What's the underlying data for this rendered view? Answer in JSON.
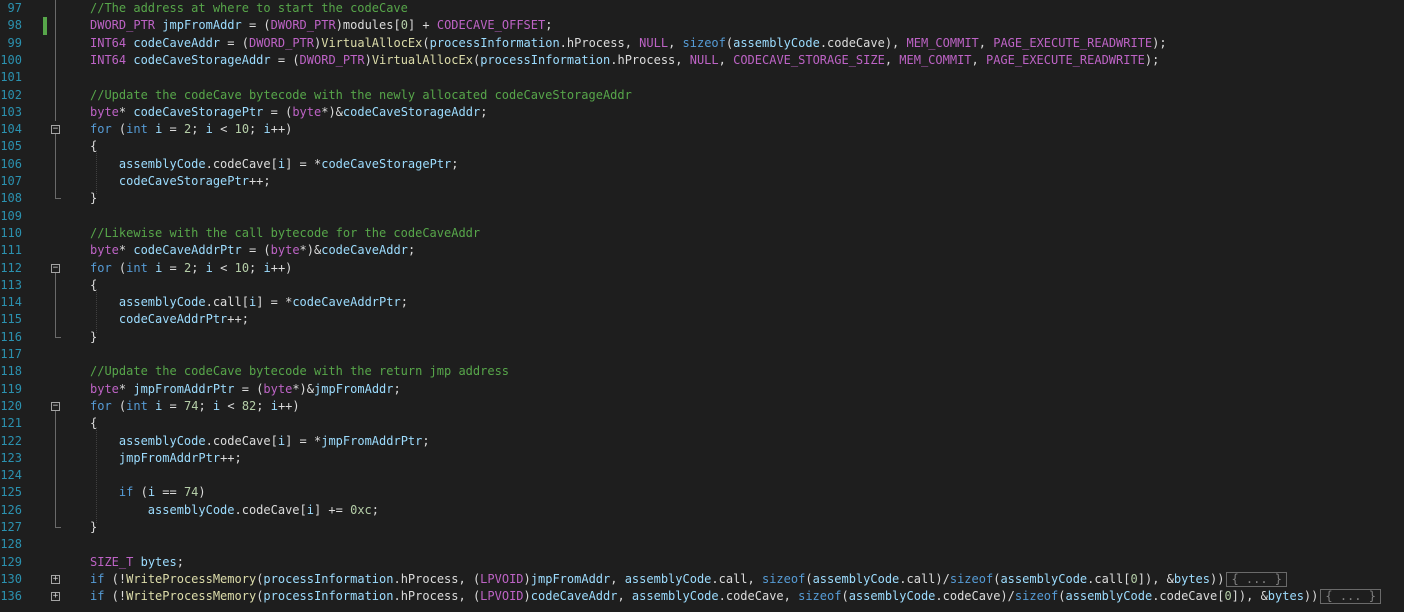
{
  "editor": {
    "colors": {
      "background": "#1e1e1e",
      "line_number": "#2b91af",
      "comment": "#57a64a",
      "keyword": "#569cd6",
      "macro": "#bd63c5",
      "function": "#dcdcaa",
      "variable": "#9cdcfe",
      "number": "#b5cea8",
      "plain": "#dcdcdc",
      "change_bar": "#57a64a"
    },
    "collapsed_label": "{ ... }",
    "lines": [
      {
        "n": "97",
        "tokens": [
          [
            "comment",
            "//The address at where to start the codeCave"
          ]
        ]
      },
      {
        "n": "98",
        "tokens": [
          [
            "macro",
            "DWORD_PTR"
          ],
          [
            "plain",
            " "
          ],
          [
            "var",
            "jmpFromAddr"
          ],
          [
            "plain",
            " = ("
          ],
          [
            "macro",
            "DWORD_PTR"
          ],
          [
            "plain",
            ")modules["
          ],
          [
            "num",
            "0"
          ],
          [
            "plain",
            "] + "
          ],
          [
            "macro",
            "CODECAVE_OFFSET"
          ],
          [
            "plain",
            ";"
          ]
        ]
      },
      {
        "n": "99",
        "tokens": [
          [
            "macro",
            "INT64"
          ],
          [
            "plain",
            " "
          ],
          [
            "var",
            "codeCaveAddr"
          ],
          [
            "plain",
            " = ("
          ],
          [
            "macro",
            "DWORD_PTR"
          ],
          [
            "plain",
            ")"
          ],
          [
            "fn",
            "VirtualAllocEx"
          ],
          [
            "plain",
            "("
          ],
          [
            "var",
            "processInformation"
          ],
          [
            "plain",
            ".hProcess, "
          ],
          [
            "macro",
            "NULL"
          ],
          [
            "plain",
            ", "
          ],
          [
            "kw",
            "sizeof"
          ],
          [
            "plain",
            "("
          ],
          [
            "var",
            "assemblyCode"
          ],
          [
            "plain",
            ".codeCave), "
          ],
          [
            "macro",
            "MEM_COMMIT"
          ],
          [
            "plain",
            ", "
          ],
          [
            "macro",
            "PAGE_EXECUTE_READWRITE"
          ],
          [
            "plain",
            ");"
          ]
        ]
      },
      {
        "n": "100",
        "tokens": [
          [
            "macro",
            "INT64"
          ],
          [
            "plain",
            " "
          ],
          [
            "var",
            "codeCaveStorageAddr"
          ],
          [
            "plain",
            " = ("
          ],
          [
            "macro",
            "DWORD_PTR"
          ],
          [
            "plain",
            ")"
          ],
          [
            "fn",
            "VirtualAllocEx"
          ],
          [
            "plain",
            "("
          ],
          [
            "var",
            "processInformation"
          ],
          [
            "plain",
            ".hProcess, "
          ],
          [
            "macro",
            "NULL"
          ],
          [
            "plain",
            ", "
          ],
          [
            "macro",
            "CODECAVE_STORAGE_SIZE"
          ],
          [
            "plain",
            ", "
          ],
          [
            "macro",
            "MEM_COMMIT"
          ],
          [
            "plain",
            ", "
          ],
          [
            "macro",
            "PAGE_EXECUTE_READWRITE"
          ],
          [
            "plain",
            ");"
          ]
        ]
      },
      {
        "n": "101",
        "tokens": []
      },
      {
        "n": "102",
        "tokens": [
          [
            "comment",
            "//Update the codeCave bytecode with the newly allocated codeCaveStorageAddr"
          ]
        ]
      },
      {
        "n": "103",
        "tokens": [
          [
            "macro",
            "byte"
          ],
          [
            "plain",
            "* "
          ],
          [
            "var",
            "codeCaveStoragePtr"
          ],
          [
            "plain",
            " = ("
          ],
          [
            "macro",
            "byte"
          ],
          [
            "plain",
            "*)&"
          ],
          [
            "var",
            "codeCaveStorageAddr"
          ],
          [
            "plain",
            ";"
          ]
        ]
      },
      {
        "n": "104",
        "tokens": [
          [
            "kw",
            "for"
          ],
          [
            "plain",
            " ("
          ],
          [
            "kw",
            "int"
          ],
          [
            "plain",
            " "
          ],
          [
            "var",
            "i"
          ],
          [
            "plain",
            " = "
          ],
          [
            "num",
            "2"
          ],
          [
            "plain",
            "; "
          ],
          [
            "var",
            "i"
          ],
          [
            "plain",
            " < "
          ],
          [
            "num",
            "10"
          ],
          [
            "plain",
            "; "
          ],
          [
            "var",
            "i"
          ],
          [
            "plain",
            "++)"
          ]
        ]
      },
      {
        "n": "105",
        "tokens": [
          [
            "plain",
            "{"
          ]
        ]
      },
      {
        "n": "106",
        "tokens": [
          [
            "plain",
            "    "
          ],
          [
            "var",
            "assemblyCode"
          ],
          [
            "plain",
            ".codeCave["
          ],
          [
            "var",
            "i"
          ],
          [
            "plain",
            "] = *"
          ],
          [
            "var",
            "codeCaveStoragePtr"
          ],
          [
            "plain",
            ";"
          ]
        ]
      },
      {
        "n": "107",
        "tokens": [
          [
            "plain",
            "    "
          ],
          [
            "var",
            "codeCaveStoragePtr"
          ],
          [
            "plain",
            "++;"
          ]
        ]
      },
      {
        "n": "108",
        "tokens": [
          [
            "plain",
            "}"
          ]
        ]
      },
      {
        "n": "109",
        "tokens": []
      },
      {
        "n": "110",
        "tokens": [
          [
            "comment",
            "//Likewise with the call bytecode for the codeCaveAddr"
          ]
        ]
      },
      {
        "n": "111",
        "tokens": [
          [
            "macro",
            "byte"
          ],
          [
            "plain",
            "* "
          ],
          [
            "var",
            "codeCaveAddrPtr"
          ],
          [
            "plain",
            " = ("
          ],
          [
            "macro",
            "byte"
          ],
          [
            "plain",
            "*)&"
          ],
          [
            "var",
            "codeCaveAddr"
          ],
          [
            "plain",
            ";"
          ]
        ]
      },
      {
        "n": "112",
        "tokens": [
          [
            "kw",
            "for"
          ],
          [
            "plain",
            " ("
          ],
          [
            "kw",
            "int"
          ],
          [
            "plain",
            " "
          ],
          [
            "var",
            "i"
          ],
          [
            "plain",
            " = "
          ],
          [
            "num",
            "2"
          ],
          [
            "plain",
            "; "
          ],
          [
            "var",
            "i"
          ],
          [
            "plain",
            " < "
          ],
          [
            "num",
            "10"
          ],
          [
            "plain",
            "; "
          ],
          [
            "var",
            "i"
          ],
          [
            "plain",
            "++)"
          ]
        ]
      },
      {
        "n": "113",
        "tokens": [
          [
            "plain",
            "{"
          ]
        ]
      },
      {
        "n": "114",
        "tokens": [
          [
            "plain",
            "    "
          ],
          [
            "var",
            "assemblyCode"
          ],
          [
            "plain",
            ".call["
          ],
          [
            "var",
            "i"
          ],
          [
            "plain",
            "] = *"
          ],
          [
            "var",
            "codeCaveAddrPtr"
          ],
          [
            "plain",
            ";"
          ]
        ]
      },
      {
        "n": "115",
        "tokens": [
          [
            "plain",
            "    "
          ],
          [
            "var",
            "codeCaveAddrPtr"
          ],
          [
            "plain",
            "++;"
          ]
        ]
      },
      {
        "n": "116",
        "tokens": [
          [
            "plain",
            "}"
          ]
        ]
      },
      {
        "n": "117",
        "tokens": []
      },
      {
        "n": "118",
        "tokens": [
          [
            "comment",
            "//Update the codeCave bytecode with the return jmp address"
          ]
        ]
      },
      {
        "n": "119",
        "tokens": [
          [
            "macro",
            "byte"
          ],
          [
            "plain",
            "* "
          ],
          [
            "var",
            "jmpFromAddrPtr"
          ],
          [
            "plain",
            " = ("
          ],
          [
            "macro",
            "byte"
          ],
          [
            "plain",
            "*)&"
          ],
          [
            "var",
            "jmpFromAddr"
          ],
          [
            "plain",
            ";"
          ]
        ]
      },
      {
        "n": "120",
        "tokens": [
          [
            "kw",
            "for"
          ],
          [
            "plain",
            " ("
          ],
          [
            "kw",
            "int"
          ],
          [
            "plain",
            " "
          ],
          [
            "var",
            "i"
          ],
          [
            "plain",
            " = "
          ],
          [
            "num",
            "74"
          ],
          [
            "plain",
            "; "
          ],
          [
            "var",
            "i"
          ],
          [
            "plain",
            " < "
          ],
          [
            "num",
            "82"
          ],
          [
            "plain",
            "; "
          ],
          [
            "var",
            "i"
          ],
          [
            "plain",
            "++)"
          ]
        ]
      },
      {
        "n": "121",
        "tokens": [
          [
            "plain",
            "{"
          ]
        ]
      },
      {
        "n": "122",
        "tokens": [
          [
            "plain",
            "    "
          ],
          [
            "var",
            "assemblyCode"
          ],
          [
            "plain",
            ".codeCave["
          ],
          [
            "var",
            "i"
          ],
          [
            "plain",
            "] = *"
          ],
          [
            "var",
            "jmpFromAddrPtr"
          ],
          [
            "plain",
            ";"
          ]
        ]
      },
      {
        "n": "123",
        "tokens": [
          [
            "plain",
            "    "
          ],
          [
            "var",
            "jmpFromAddrPtr"
          ],
          [
            "plain",
            "++;"
          ]
        ]
      },
      {
        "n": "124",
        "tokens": []
      },
      {
        "n": "125",
        "tokens": [
          [
            "plain",
            "    "
          ],
          [
            "kw",
            "if"
          ],
          [
            "plain",
            " ("
          ],
          [
            "var",
            "i"
          ],
          [
            "plain",
            " == "
          ],
          [
            "num",
            "74"
          ],
          [
            "plain",
            ")"
          ]
        ]
      },
      {
        "n": "126",
        "tokens": [
          [
            "plain",
            "        "
          ],
          [
            "var",
            "assemblyCode"
          ],
          [
            "plain",
            ".codeCave["
          ],
          [
            "var",
            "i"
          ],
          [
            "plain",
            "] += "
          ],
          [
            "num",
            "0xc"
          ],
          [
            "plain",
            ";"
          ]
        ]
      },
      {
        "n": "127",
        "tokens": [
          [
            "plain",
            "}"
          ]
        ]
      },
      {
        "n": "128",
        "tokens": []
      },
      {
        "n": "129",
        "tokens": [
          [
            "macro",
            "SIZE_T"
          ],
          [
            "plain",
            " "
          ],
          [
            "var",
            "bytes"
          ],
          [
            "plain",
            ";"
          ]
        ]
      },
      {
        "n": "130",
        "tokens": [
          [
            "kw",
            "if"
          ],
          [
            "plain",
            " (!"
          ],
          [
            "fn",
            "WriteProcessMemory"
          ],
          [
            "plain",
            "("
          ],
          [
            "var",
            "processInformation"
          ],
          [
            "plain",
            ".hProcess, ("
          ],
          [
            "macro",
            "LPVOID"
          ],
          [
            "plain",
            ")"
          ],
          [
            "var",
            "jmpFromAddr"
          ],
          [
            "plain",
            ", "
          ],
          [
            "var",
            "assemblyCode"
          ],
          [
            "plain",
            ".call, "
          ],
          [
            "kw",
            "sizeof"
          ],
          [
            "plain",
            "("
          ],
          [
            "var",
            "assemblyCode"
          ],
          [
            "plain",
            ".call)/"
          ],
          [
            "kw",
            "sizeof"
          ],
          [
            "plain",
            "("
          ],
          [
            "var",
            "assemblyCode"
          ],
          [
            "plain",
            ".call["
          ],
          [
            "num",
            "0"
          ],
          [
            "plain",
            "]), &"
          ],
          [
            "var",
            "bytes"
          ],
          [
            "plain",
            "))"
          ]
        ],
        "collapsed": true
      },
      {
        "n": "136",
        "tokens": [
          [
            "kw",
            "if"
          ],
          [
            "plain",
            " (!"
          ],
          [
            "fn",
            "WriteProcessMemory"
          ],
          [
            "plain",
            "("
          ],
          [
            "var",
            "processInformation"
          ],
          [
            "plain",
            ".hProcess, ("
          ],
          [
            "macro",
            "LPVOID"
          ],
          [
            "plain",
            ")"
          ],
          [
            "var",
            "codeCaveAddr"
          ],
          [
            "plain",
            ", "
          ],
          [
            "var",
            "assemblyCode"
          ],
          [
            "plain",
            ".codeCave, "
          ],
          [
            "kw",
            "sizeof"
          ],
          [
            "plain",
            "("
          ],
          [
            "var",
            "assemblyCode"
          ],
          [
            "plain",
            ".codeCave)/"
          ],
          [
            "kw",
            "sizeof"
          ],
          [
            "plain",
            "("
          ],
          [
            "var",
            "assemblyCode"
          ],
          [
            "plain",
            ".codeCave["
          ],
          [
            "num",
            "0"
          ],
          [
            "plain",
            "]), &"
          ],
          [
            "var",
            "bytes"
          ],
          [
            "plain",
            "))"
          ]
        ],
        "collapsed": true
      }
    ]
  }
}
